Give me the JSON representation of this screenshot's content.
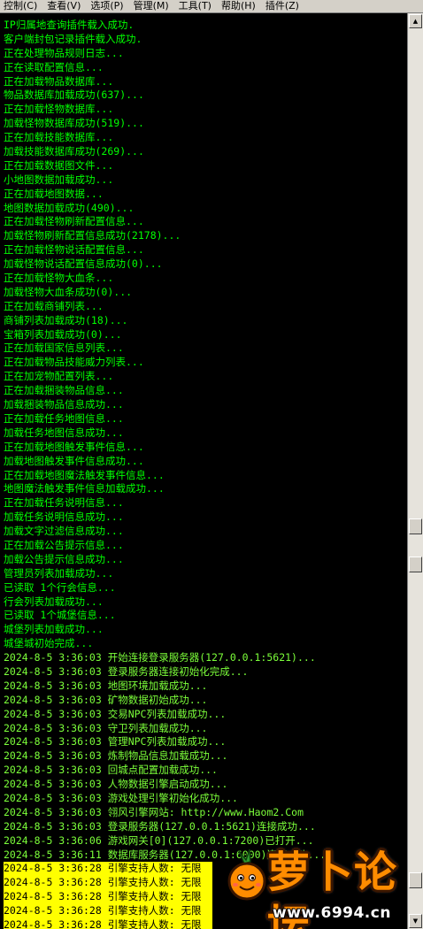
{
  "menu": [
    "控制(C)",
    "查看(V)",
    "选项(P)",
    "管理(M)",
    "工具(T)",
    "帮助(H)",
    "插件(Z)"
  ],
  "colors": {
    "normal_text": "#00ff00",
    "timestamp_text": "#7cff3a",
    "highlight_bg": "#ffff00",
    "highlight_text": "#000000",
    "console_bg": "#000000",
    "watermark_orange": "#ff8c00"
  },
  "log_lines": [
    {
      "text": "IP归属地查询插件载入成功.",
      "style": "normal"
    },
    {
      "text": "客户端封包记录插件载入成功.",
      "style": "normal"
    },
    {
      "text": "正在处理物品规则日志...",
      "style": "normal"
    },
    {
      "text": "正在读取配置信息...",
      "style": "normal"
    },
    {
      "text": "正在加载物品数据库...",
      "style": "normal"
    },
    {
      "text": "物品数据库加载成功(637)...",
      "style": "normal"
    },
    {
      "text": "正在加载怪物数据库...",
      "style": "normal"
    },
    {
      "text": "加载怪物数据库成功(519)...",
      "style": "normal"
    },
    {
      "text": "正在加载技能数据库...",
      "style": "normal"
    },
    {
      "text": "加载技能数据库成功(269)...",
      "style": "normal"
    },
    {
      "text": "正在加载数据图文件...",
      "style": "normal"
    },
    {
      "text": "小地图数据加载成功...",
      "style": "normal"
    },
    {
      "text": "正在加载地图数据...",
      "style": "normal"
    },
    {
      "text": "地图数据加载成功(490)...",
      "style": "normal"
    },
    {
      "text": "正在加载怪物刷新配置信息...",
      "style": "normal"
    },
    {
      "text": "加载怪物刷新配置信息成功(2178)...",
      "style": "normal"
    },
    {
      "text": "正在加载怪物说话配置信息...",
      "style": "normal"
    },
    {
      "text": "加载怪物说话配置信息成功(0)...",
      "style": "normal"
    },
    {
      "text": "正在加载怪物大血条...",
      "style": "normal"
    },
    {
      "text": "加载怪物大血条成功(0)...",
      "style": "normal"
    },
    {
      "text": "正在加载商铺列表...",
      "style": "normal"
    },
    {
      "text": "商铺列表加载成功(18)...",
      "style": "normal"
    },
    {
      "text": "宝箱列表加载成功(0)...",
      "style": "normal"
    },
    {
      "text": "正在加载国家信息列表...",
      "style": "normal"
    },
    {
      "text": "正在加载物品技能威力列表...",
      "style": "normal"
    },
    {
      "text": "正在加宠物配置列表...",
      "style": "normal"
    },
    {
      "text": "正在加载捆装物品信息...",
      "style": "normal"
    },
    {
      "text": "加载捆装物品信息成功...",
      "style": "normal"
    },
    {
      "text": "正在加载任务地图信息...",
      "style": "normal"
    },
    {
      "text": "加载任务地图信息成功...",
      "style": "normal"
    },
    {
      "text": "正在加载地图触发事件信息...",
      "style": "normal"
    },
    {
      "text": "加载地图触发事件信息成功...",
      "style": "normal"
    },
    {
      "text": "正在加载地图魔法触发事件信息...",
      "style": "normal"
    },
    {
      "text": "地图魔法触发事件信息加载成功...",
      "style": "normal"
    },
    {
      "text": "正在加载任务说明信息...",
      "style": "normal"
    },
    {
      "text": "加载任务说明信息成功...",
      "style": "normal"
    },
    {
      "text": "加载文字过滤信息成功...",
      "style": "normal"
    },
    {
      "text": "正在加载公告提示信息...",
      "style": "normal"
    },
    {
      "text": "加载公告提示信息成功...",
      "style": "normal"
    },
    {
      "text": "管理员列表加载成功...",
      "style": "normal"
    },
    {
      "text": "已读取 1个行会信息...",
      "style": "normal"
    },
    {
      "text": "行会列表加载成功...",
      "style": "normal"
    },
    {
      "text": "已读取 1个城堡信息...",
      "style": "normal"
    },
    {
      "text": "城堡列表加载成功...",
      "style": "normal"
    },
    {
      "text": "城堡城初始完成...",
      "style": "normal"
    },
    {
      "text": "2024-8-5 3:36:03 开始连接登录服务器(127.0.0.1:5621)...",
      "style": "time"
    },
    {
      "text": "2024-8-5 3:36:03 登录服务器连接初始化完成...",
      "style": "time"
    },
    {
      "text": "2024-8-5 3:36:03 地图环境加载成功...",
      "style": "time"
    },
    {
      "text": "2024-8-5 3:36:03 矿物数据初始成功...",
      "style": "time"
    },
    {
      "text": "2024-8-5 3:36:03 交易NPC列表加载成功...",
      "style": "time"
    },
    {
      "text": "2024-8-5 3:36:03 守卫列表加载成功...",
      "style": "time"
    },
    {
      "text": "2024-8-5 3:36:03 管理NPC列表加载成功...",
      "style": "time"
    },
    {
      "text": "2024-8-5 3:36:03 炼制物品信息加载成功...",
      "style": "time"
    },
    {
      "text": "2024-8-5 3:36:03 回城点配置加载成功...",
      "style": "time"
    },
    {
      "text": "2024-8-5 3:36:03 人物数据引擎启动成功...",
      "style": "time"
    },
    {
      "text": "2024-8-5 3:36:03 游戏处理引擎初始化成功...",
      "style": "time"
    },
    {
      "text": "2024-8-5 3:36:03 翎风引擎网站: http://www.Haom2.Com",
      "style": "time"
    },
    {
      "text": "2024-8-5 3:36:03 登录服务器(127.0.0.1:5621)连接成功...",
      "style": "time"
    },
    {
      "text": "2024-8-5 3:36:06 游戏网关[0](127.0.0.1:7200)已打开...",
      "style": "time"
    },
    {
      "text": "2024-8-5 3:36:11 数据库服务器(127.0.0.1:6000)连接成功...",
      "style": "time"
    },
    {
      "text": "2024-8-5 3:36:28 引擎支持人数: 无限",
      "style": "hl"
    },
    {
      "text": "2024-8-5 3:36:28 引擎支持人数: 无限",
      "style": "hl"
    },
    {
      "text": "2024-8-5 3:36:28 引擎支持人数: 无限",
      "style": "hl"
    },
    {
      "text": "2024-8-5 3:36:28 引擎支持人数: 无限",
      "style": "hl"
    },
    {
      "text": "2024-8-5 3:36:28 引擎支持人数: 无限",
      "style": "hl"
    }
  ],
  "watermark": {
    "title": "萝卜论坛",
    "url": "www.6994.cn",
    "mascot_icon": "carrot-mascot-icon"
  }
}
